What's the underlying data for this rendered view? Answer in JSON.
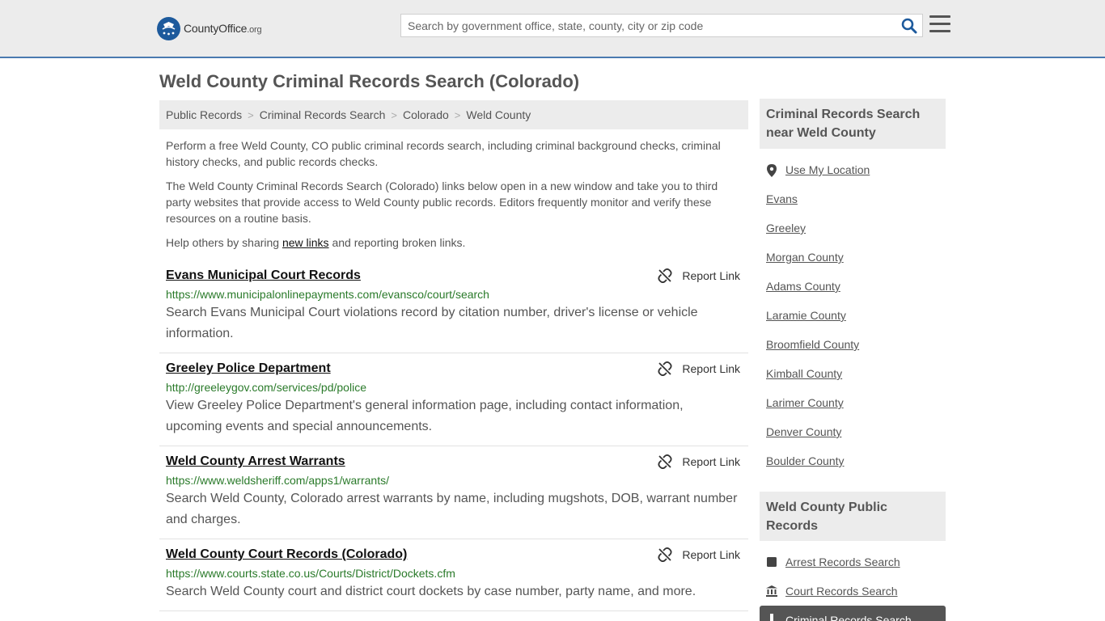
{
  "header": {
    "logo_main": "CountyOffice",
    "logo_suffix": ".org",
    "search_placeholder": "Search by government office, state, county, city or zip code"
  },
  "page_title": "Weld County Criminal Records Search (Colorado)",
  "breadcrumb": [
    "Public Records",
    "Criminal Records Search",
    "Colorado",
    "Weld County"
  ],
  "intro": {
    "p1": "Perform a free Weld County, CO public criminal records search, including criminal background checks, criminal history checks, and public records checks.",
    "p2": "The Weld County Criminal Records Search (Colorado) links below open in a new window and take you to third party websites that provide access to Weld County public records. Editors frequently monitor and verify these resources on a routine basis.",
    "p3_before": "Help others by sharing ",
    "p3_link": "new links",
    "p3_after": " and reporting broken links."
  },
  "report_label": "Report Link",
  "results": [
    {
      "title": "Evans Municipal Court Records",
      "url": "https://www.municipalonlinepayments.com/evansco/court/search",
      "desc": "Search Evans Municipal Court violations record by citation number, driver's license or vehicle information."
    },
    {
      "title": "Greeley Police Department",
      "url": "http://greeleygov.com/services/pd/police",
      "desc": "View Greeley Police Department's general information page, including contact information, upcoming events and special announcements."
    },
    {
      "title": "Weld County Arrest Warrants",
      "url": "https://www.weldsheriff.com/apps1/warrants/",
      "desc": "Search Weld County, Colorado arrest warrants by name, including mugshots, DOB, warrant number and charges."
    },
    {
      "title": "Weld County Court Records (Colorado)",
      "url": "https://www.courts.state.co.us/Courts/District/Dockets.cfm",
      "desc": "Search Weld County court and district court dockets by case number, party name, and more."
    }
  ],
  "sidebar": {
    "nearby_title": "Criminal Records Search near Weld County",
    "use_location": "Use My Location",
    "nearby": [
      "Evans",
      "Greeley",
      "Morgan County",
      "Adams County",
      "Laramie County",
      "Broomfield County",
      "Kimball County",
      "Larimer County",
      "Denver County",
      "Boulder County"
    ],
    "public_records_title": "Weld County Public Records",
    "public_records": [
      "Arrest Records Search",
      "Court Records Search"
    ],
    "active_item": "Criminal Records Search"
  },
  "colors": {
    "brand_blue": "#1d5a9c",
    "header_bg": "#ececec",
    "url_green": "#2a7a2a",
    "active_bg": "#555555"
  }
}
